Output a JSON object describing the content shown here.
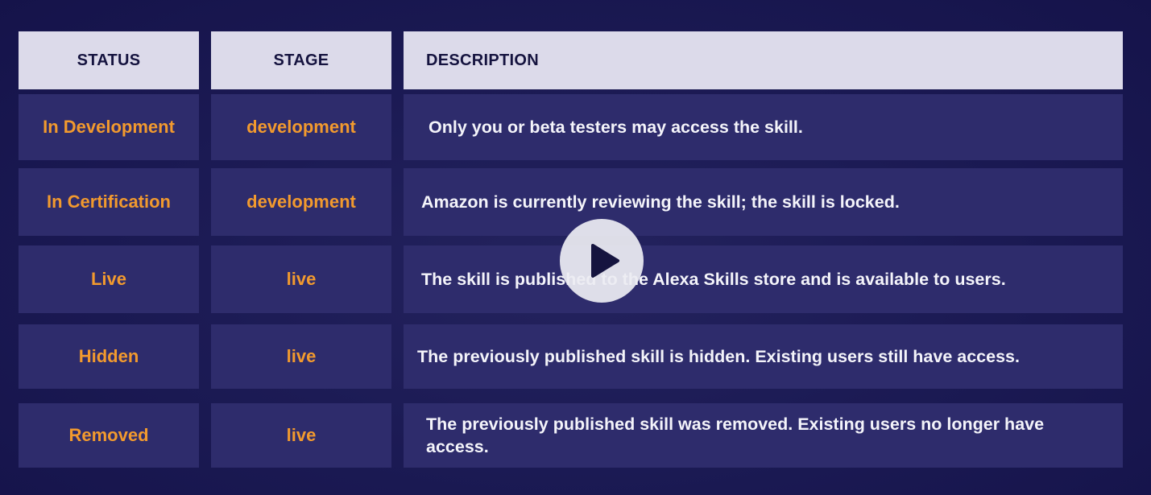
{
  "table": {
    "headers": {
      "status": "STATUS",
      "stage": "STAGE",
      "description": "DESCRIPTION"
    },
    "rows": [
      {
        "status": "In Development",
        "stage": "development",
        "description": "Only you or beta testers may access the skill."
      },
      {
        "status": "In Certification",
        "stage": "development",
        "description": "Amazon is currently reviewing the skill; the skill is locked."
      },
      {
        "status": "Live",
        "stage": "live",
        "description": "The skill is published to the Alexa Skills store and is available to users."
      },
      {
        "status": "Hidden",
        "stage": "live",
        "description": "The previously published skill is hidden. Existing users still have access."
      },
      {
        "status": "Removed",
        "stage": "live",
        "description": "The previously published skill  was removed. Existing users no longer have access."
      }
    ]
  },
  "video": {
    "play_icon": "play-icon"
  },
  "colors": {
    "status_text": "#f29a2e",
    "header_bg": "#dcdaea",
    "cell_bg": "#2e2c6c",
    "background": "#1c1b55"
  }
}
